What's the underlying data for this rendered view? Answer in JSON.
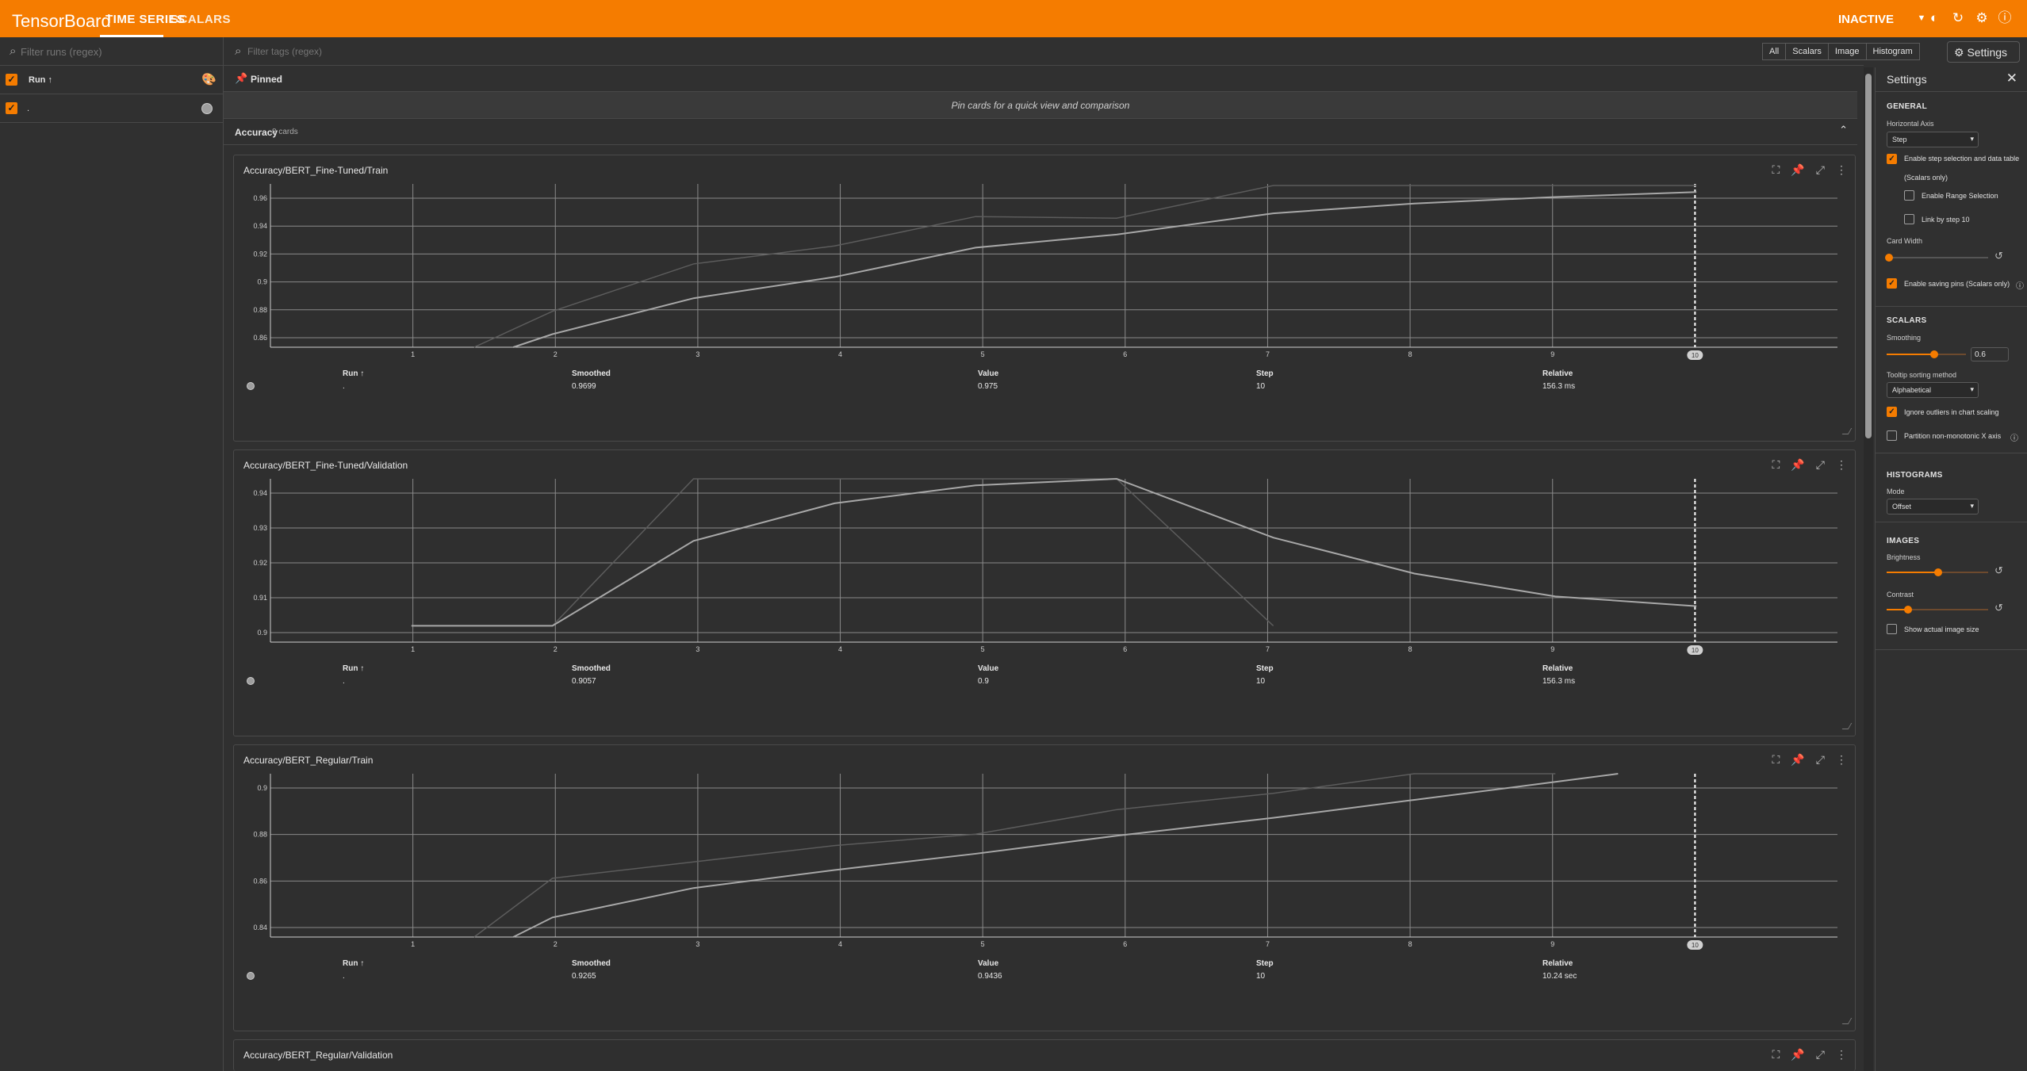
{
  "header": {
    "brand": "TensorBoard",
    "tabs": [
      "TIME SERIES",
      "SCALARS"
    ],
    "status": "INACTIVE"
  },
  "colors": {
    "accent": "#f57c00",
    "bg": "#303030"
  },
  "runs_panel": {
    "search_placeholder": "Filter runs (regex)",
    "header_label": "Run ↑",
    "runs": [
      {
        "name": ".",
        "checked": true
      }
    ]
  },
  "filter": {
    "placeholder": "Filter tags (regex)",
    "types": [
      "All",
      "Scalars",
      "Image",
      "Histogram"
    ],
    "settings_label": "Settings"
  },
  "pinned": {
    "label": "Pinned",
    "message": "Pin cards for a quick view and comparison"
  },
  "group": {
    "name": "Accuracy",
    "count": "8 cards"
  },
  "table_headers": {
    "run": "Run ↑",
    "smoothed": "Smoothed",
    "value": "Value",
    "step": "Step",
    "relative": "Relative"
  },
  "x_ticks": [
    "1",
    "2",
    "3",
    "4",
    "5",
    "6",
    "7",
    "8",
    "9"
  ],
  "step_marker": "10",
  "cards": [
    {
      "title": "Accuracy/BERT_Fine-Tuned/Train",
      "y_ticks": [
        "0.96",
        "0.94",
        "0.92",
        "0.9",
        "0.88",
        "0.86"
      ],
      "row": {
        "run": ".",
        "smoothed": "0.9699",
        "value": "0.975",
        "step": "10",
        "relative": "156.3 ms"
      }
    },
    {
      "title": "Accuracy/BERT_Fine-Tuned/Validation",
      "y_ticks": [
        "0.94",
        "0.93",
        "0.92",
        "0.91",
        "0.9"
      ],
      "row": {
        "run": ".",
        "smoothed": "0.9057",
        "value": "0.9",
        "step": "10",
        "relative": "156.3 ms"
      }
    },
    {
      "title": "Accuracy/BERT_Regular/Train",
      "y_ticks": [
        "0.9",
        "0.88",
        "0.86",
        "0.84"
      ],
      "row": {
        "run": ".",
        "smoothed": "0.9265",
        "value": "0.9436",
        "step": "10",
        "relative": "10.24 sec"
      }
    },
    {
      "title": "Accuracy/BERT_Regular/Validation"
    }
  ],
  "settings": {
    "title": "Settings",
    "general": "GENERAL",
    "horizontal_axis_label": "Horizontal Axis",
    "horizontal_axis_value": "Step",
    "enable_step_selection": "Enable step selection and data table",
    "scalars_only": "(Scalars only)",
    "enable_range": "Enable Range Selection",
    "link_by_step": "Link by step 10",
    "card_width": "Card Width",
    "enable_saving_pins": "Enable saving pins (Scalars only)",
    "scalars": "SCALARS",
    "smoothing_label": "Smoothing",
    "smoothing_value": "0.6",
    "smoothing_level": 0.6,
    "tooltip_label": "Tooltip sorting method",
    "tooltip_value": "Alphabetical",
    "ignore_outliers": "Ignore outliers in chart scaling",
    "partition": "Partition non-monotonic X axis",
    "histograms": "HISTOGRAMS",
    "mode_label": "Mode",
    "mode_value": "Offset",
    "images": "IMAGES",
    "brightness": "Brightness",
    "contrast": "Contrast",
    "show_actual": "Show actual image size"
  }
}
